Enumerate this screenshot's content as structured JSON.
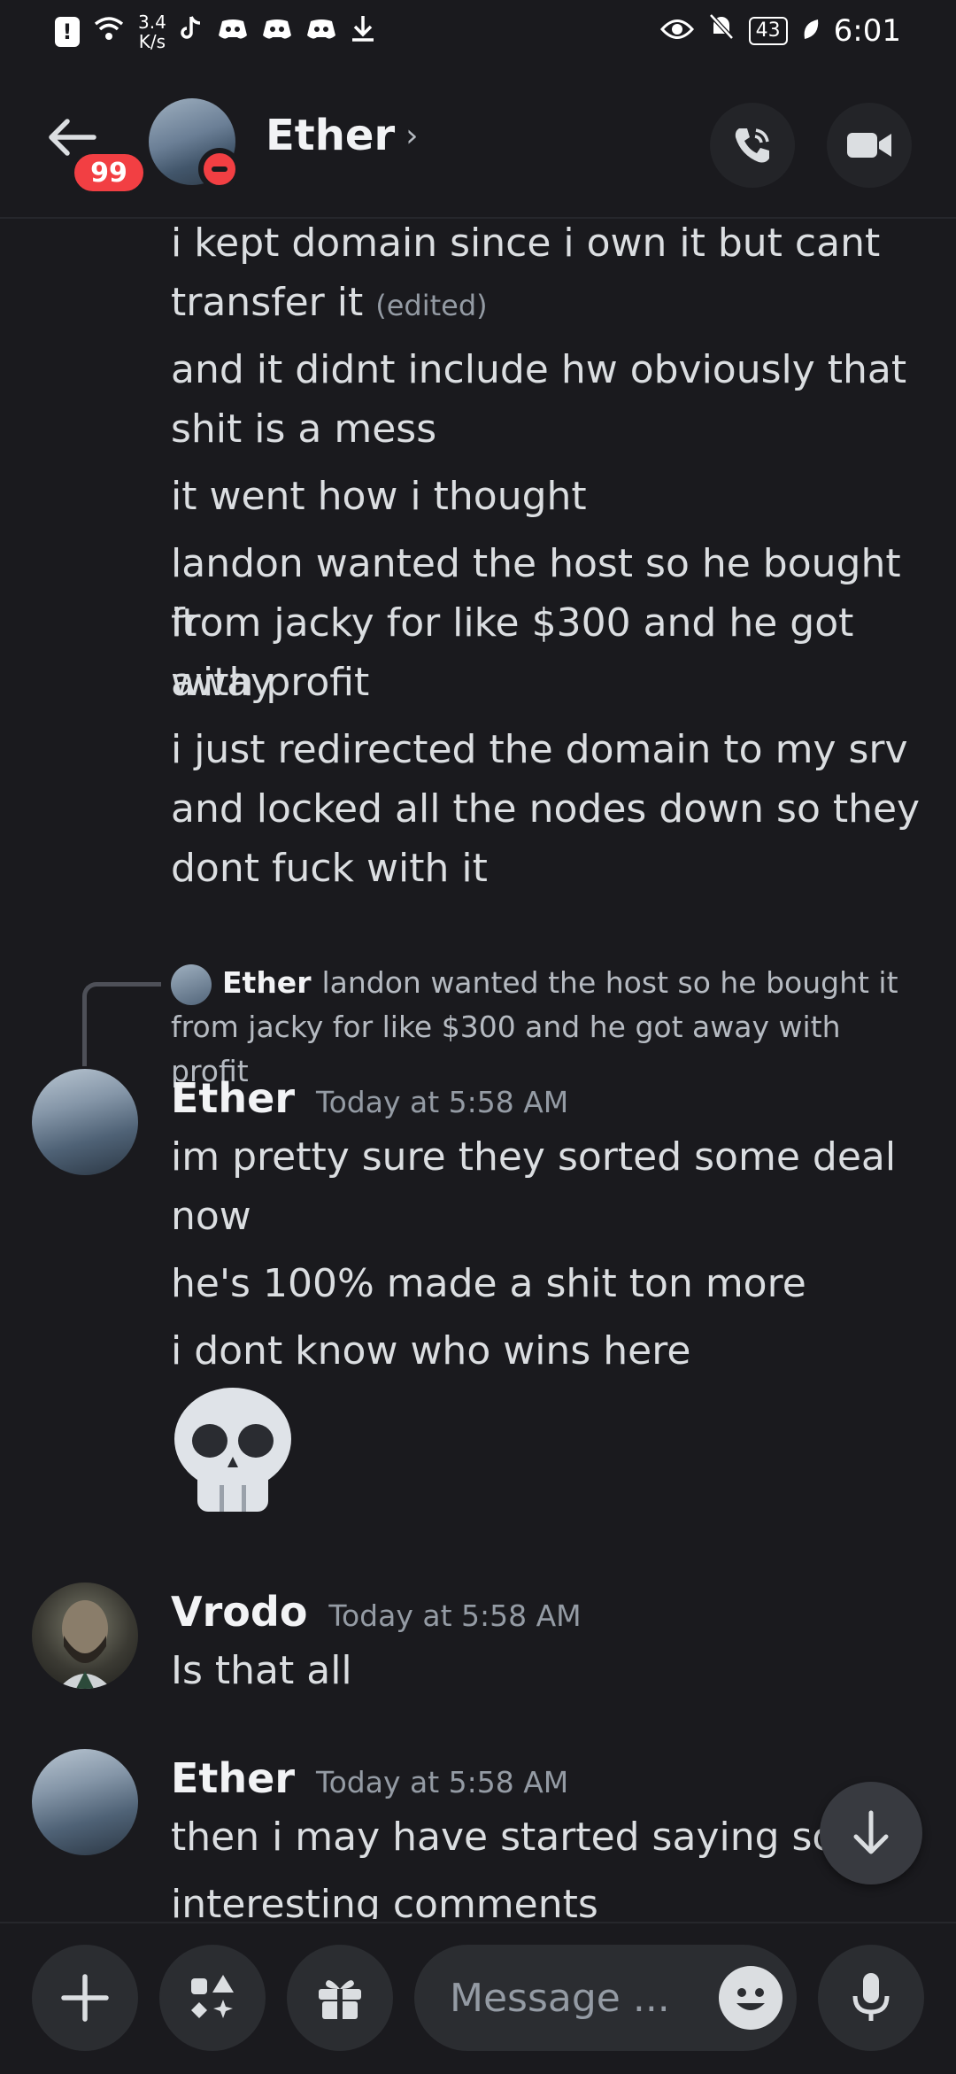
{
  "status_bar": {
    "net_speed_value": "3.4",
    "net_speed_unit": "K/s",
    "battery": "43",
    "time": "6:01"
  },
  "header": {
    "unread_count": "99",
    "title": "Ether",
    "chevron": "›"
  },
  "messages": {
    "top_lines": [
      "i kept domain since i own it but cant",
      "transfer it",
      "and it didnt include hw obviously that",
      "shit is a mess",
      "it went how i thought",
      "landon wanted the host so he bought it",
      "from jacky for like $300 and he got away",
      "with profit",
      "i just redirected the domain to my srv",
      "and locked all the nodes down so they",
      "dont fuck with it"
    ],
    "edited_label": "(edited)",
    "reply": {
      "name": "Ether",
      "text_line1": "landon wanted the host so he bought it",
      "text_line2": "from jacky for like $300 and he got away with profit"
    },
    "group1": {
      "author": "Ether",
      "time": "Today at 5:58 AM",
      "lines": [
        "im pretty sure they sorted some deal",
        "now",
        "he's 100% made a shit ton more",
        "i dont know who wins here"
      ],
      "emoji": "skull"
    },
    "group2": {
      "author": "Vrodo",
      "time": "Today at 5:58 AM",
      "lines": [
        "Is that all"
      ]
    },
    "group3": {
      "author": "Ether",
      "time": "Today at 5:58 AM",
      "lines": [
        "then i may have started saying some",
        "interesting comments"
      ]
    }
  },
  "composer": {
    "placeholder": "Message ..."
  },
  "colors": {
    "background": "#1a1a1e",
    "badge_red": "#f23f43",
    "button_bg": "#2b2d31"
  },
  "icons": [
    "back-arrow-icon",
    "call-icon",
    "video-icon",
    "plus-icon",
    "apps-icon",
    "gift-icon",
    "emoji-icon",
    "mic-icon",
    "arrow-down-icon",
    "skull-emoji"
  ]
}
